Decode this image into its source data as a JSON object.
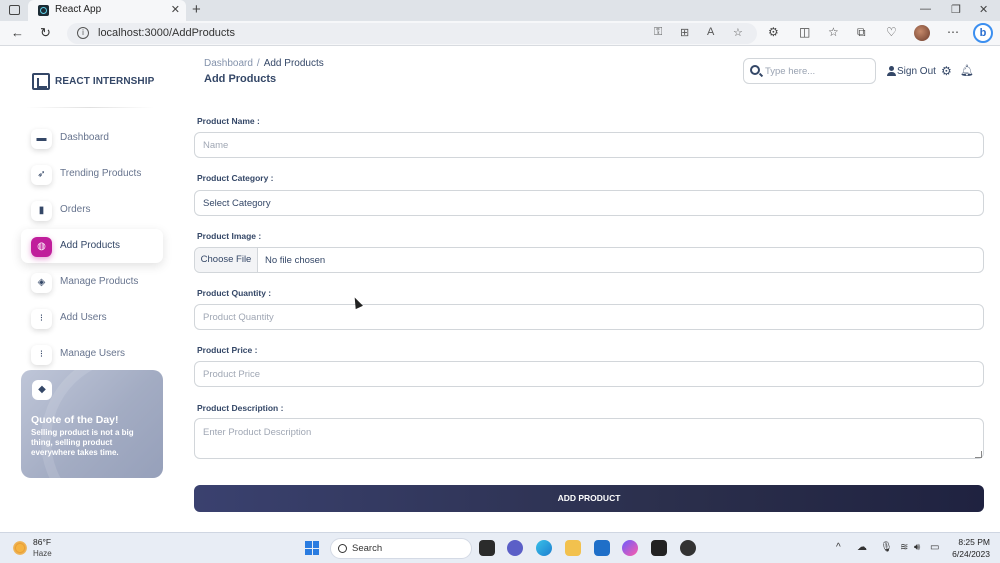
{
  "browser": {
    "tab_title": "React App",
    "tab_close": "✕",
    "new_tab": "+",
    "url": "localhost:3000/AddProducts",
    "window_controls": {
      "minimize": "—",
      "maximize": "❐",
      "close": "✕"
    }
  },
  "sidebar": {
    "brand": "REACT INTERNSHIP",
    "items": [
      {
        "label": "Dashboard",
        "icon": "store-icon",
        "glyph": "▬",
        "active": false
      },
      {
        "label": "Trending Products",
        "icon": "rocket-icon",
        "glyph": "➶",
        "active": false
      },
      {
        "label": "Orders",
        "icon": "bar-chart-icon",
        "glyph": "▮",
        "active": false
      },
      {
        "label": "Add Products",
        "icon": "globe-icon",
        "glyph": "◍",
        "active": true
      },
      {
        "label": "Manage Products",
        "icon": "layers-icon",
        "glyph": "◈",
        "active": false
      },
      {
        "label": "Add Users",
        "icon": "add-user-icon",
        "glyph": "⁝",
        "active": false
      },
      {
        "label": "Manage Users",
        "icon": "users-icon",
        "glyph": "⁝",
        "active": false
      }
    ],
    "quote": {
      "title": "Quote of the Day!",
      "text": "Selling product is not a big thing, selling product everywhere takes time."
    }
  },
  "header": {
    "breadcrumb_parent": "Dashboard",
    "breadcrumb_sep": "/",
    "breadcrumb_current": "Add Products",
    "title": "Add Products",
    "search_placeholder": "Type here...",
    "signout_label": "Sign Out"
  },
  "form": {
    "name_label": "Product Name :",
    "name_placeholder": "Name",
    "category_label": "Product Category :",
    "category_value": "Select Category",
    "image_label": "Product Image :",
    "file_button": "Choose File",
    "file_status": "No file chosen",
    "quantity_label": "Product Quantity :",
    "quantity_placeholder": "Product Quantity",
    "price_label": "Product Price :",
    "price_placeholder": "Product Price",
    "description_label": "Product Description :",
    "description_placeholder": "Enter Product Description",
    "submit_label": "ADD PRODUCT"
  },
  "taskbar": {
    "temperature": "86°F",
    "weather": "Haze",
    "search_label": "Search",
    "time": "8:25 PM",
    "date": "6/24/2023"
  },
  "colors": {
    "accent_active": "#c01e9b",
    "primary_text": "#344767",
    "button_dark": "#2b2f4c"
  }
}
